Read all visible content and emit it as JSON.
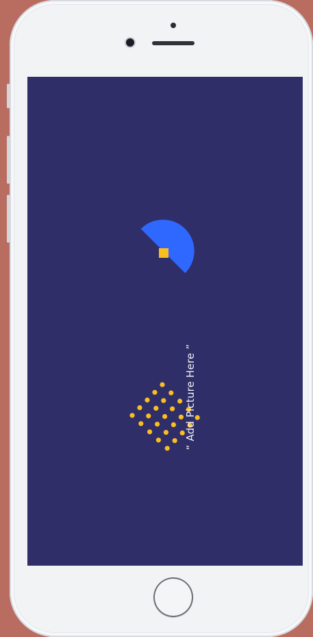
{
  "device": {
    "type": "smartphone",
    "frame_color": "#f2f3f5",
    "background_color": "#b86d60"
  },
  "screen": {
    "background_color": "#2f2e68",
    "placeholder_text": "“ Add Picture Here ”"
  },
  "decorations": {
    "semicircle_color": "#2f68ff",
    "square_color": "#f9be20",
    "dot_color": "#f9be20",
    "dot_grid": "diamond of yellow dots"
  },
  "controls": {
    "home_button": "home-button"
  }
}
